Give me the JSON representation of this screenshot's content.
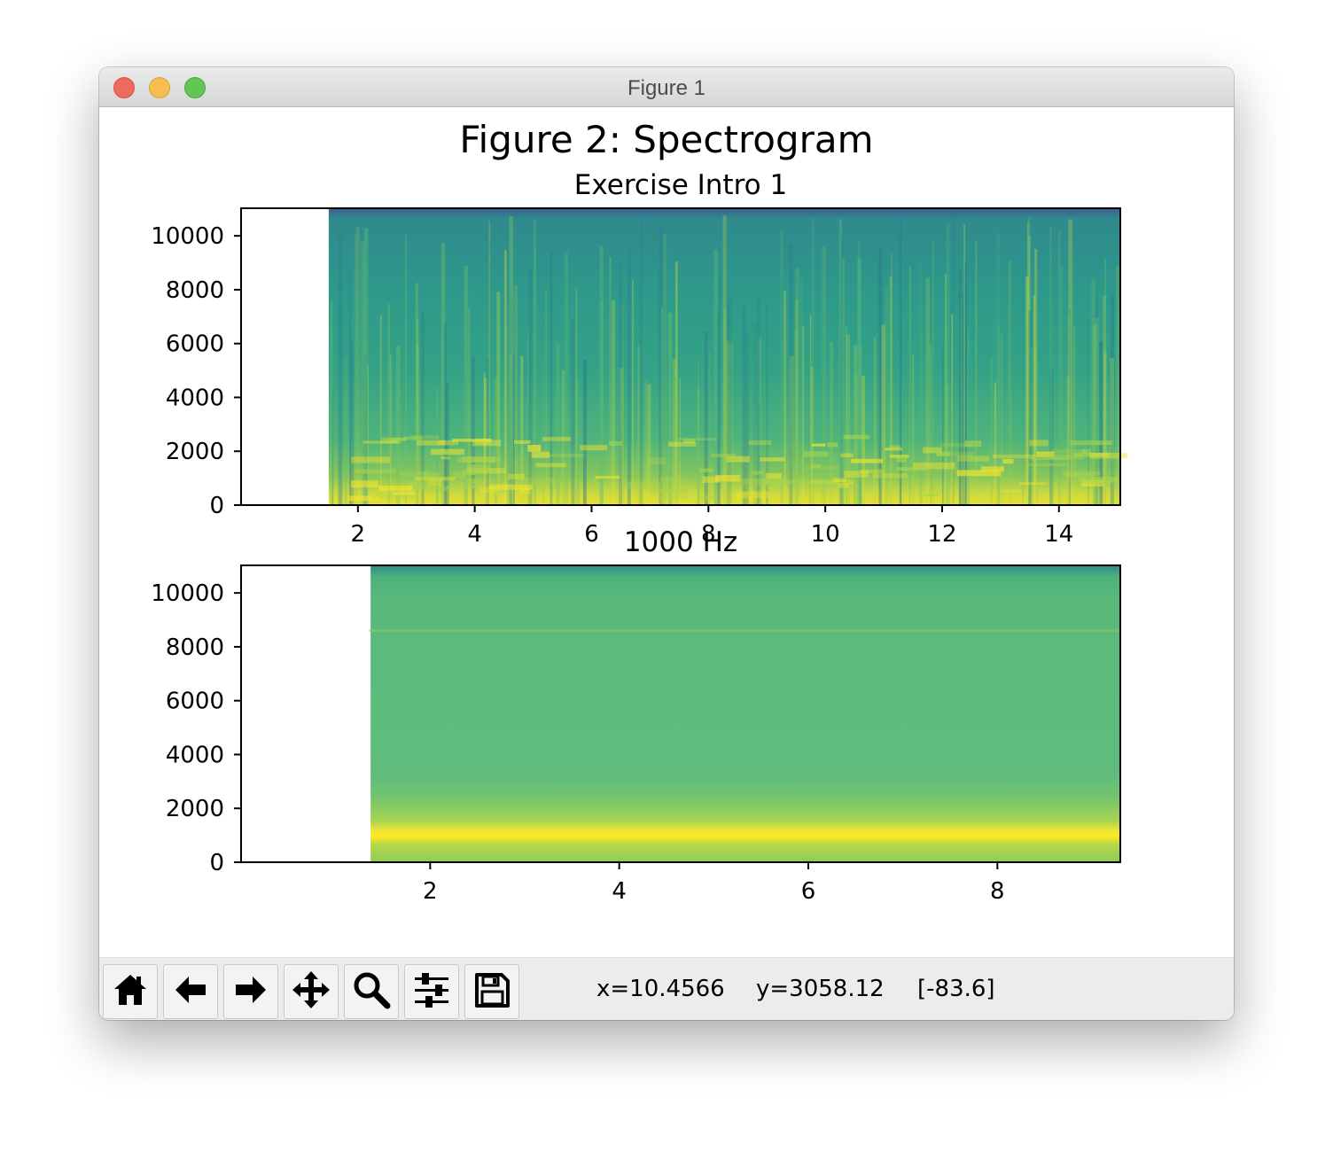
{
  "window": {
    "title": "Figure 1"
  },
  "figure": {
    "suptitle": "Figure 2: Spectrogram",
    "colormap": "viridis",
    "colors": {
      "high": "#fde725",
      "mid": "#5ec962",
      "low": "#3b528b"
    }
  },
  "chart_data": [
    {
      "type": "heatmap",
      "title": "Exercise Intro 1",
      "xlim": [
        0,
        15.05
      ],
      "ylim": [
        0,
        11025
      ],
      "data_x_start": 1.5,
      "xticks": [
        2,
        4,
        6,
        8,
        10,
        12,
        14
      ],
      "xtick_labels": [
        "2",
        "4",
        "6",
        "8",
        "10",
        "12",
        "14"
      ],
      "yticks": [
        0,
        2000,
        4000,
        6000,
        8000,
        10000
      ],
      "ytick_labels": [
        "0",
        "2000",
        "4000",
        "6000",
        "8000",
        "10000"
      ],
      "xlabel": "",
      "ylabel": ""
    },
    {
      "type": "heatmap",
      "title": "1000 Hz",
      "xlim": [
        0,
        9.3
      ],
      "ylim": [
        0,
        11025
      ],
      "data_x_start": 1.37,
      "tone_frequency_hz": 1000,
      "xticks": [
        2,
        4,
        6,
        8
      ],
      "xtick_labels": [
        "2",
        "4",
        "6",
        "8"
      ],
      "yticks": [
        0,
        2000,
        4000,
        6000,
        8000,
        10000
      ],
      "ytick_labels": [
        "0",
        "2000",
        "4000",
        "6000",
        "8000",
        "10000"
      ],
      "xlabel": "",
      "ylabel": ""
    }
  ],
  "toolbar": {
    "buttons": [
      {
        "icon": "home-icon"
      },
      {
        "icon": "back-arrow-icon"
      },
      {
        "icon": "forward-arrow-icon"
      },
      {
        "icon": "pan-move-icon"
      },
      {
        "icon": "zoom-magnifier-icon"
      },
      {
        "icon": "configure-subplots-icon"
      },
      {
        "icon": "save-floppy-icon"
      }
    ],
    "status": {
      "x": "x=10.4566",
      "y": "y=3058.12",
      "value": "[-83.6]"
    }
  }
}
